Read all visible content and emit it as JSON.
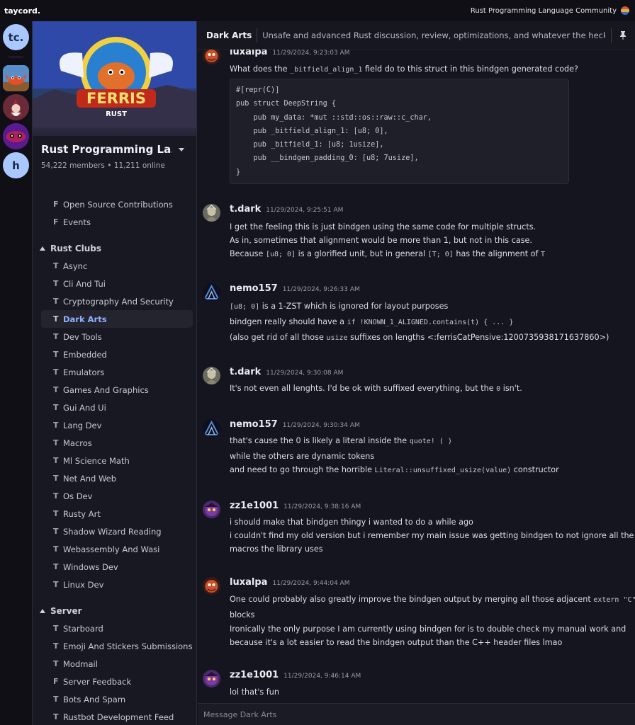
{
  "app": {
    "brand": "taycord.",
    "guild_title": "Rust Programming Language Community"
  },
  "rail": {
    "home_label": "tc.",
    "h_label": "h"
  },
  "server": {
    "banner_text": "FERRIS",
    "banner_sub": "RUST",
    "name": "Rust Programming La...",
    "stats": "54,222 members • 11,211 online"
  },
  "sidebar": {
    "top_channels": [
      {
        "type": "F",
        "name": "Open Source Contributions"
      },
      {
        "type": "F",
        "name": "Events"
      }
    ],
    "cat_clubs": "Rust Clubs",
    "clubs": [
      {
        "type": "T",
        "name": "Async"
      },
      {
        "type": "T",
        "name": "Cli And Tui"
      },
      {
        "type": "T",
        "name": "Cryptography And Security"
      },
      {
        "type": "T",
        "name": "Dark Arts"
      },
      {
        "type": "T",
        "name": "Dev Tools"
      },
      {
        "type": "T",
        "name": "Embedded"
      },
      {
        "type": "T",
        "name": "Emulators"
      },
      {
        "type": "T",
        "name": "Games And Graphics"
      },
      {
        "type": "T",
        "name": "Gui And Ui"
      },
      {
        "type": "T",
        "name": "Lang Dev"
      },
      {
        "type": "T",
        "name": "Macros"
      },
      {
        "type": "T",
        "name": "Ml Science Math"
      },
      {
        "type": "T",
        "name": "Net And Web"
      },
      {
        "type": "T",
        "name": "Os Dev"
      },
      {
        "type": "T",
        "name": "Rusty Art"
      },
      {
        "type": "T",
        "name": "Shadow Wizard Reading"
      },
      {
        "type": "T",
        "name": "Webassembly And Wasi"
      },
      {
        "type": "T",
        "name": "Windows Dev"
      },
      {
        "type": "T",
        "name": "Linux Dev"
      }
    ],
    "cat_server": "Server",
    "server_channels": [
      {
        "type": "T",
        "name": "Starboard"
      },
      {
        "type": "T",
        "name": "Emoji And Stickers Submissions"
      },
      {
        "type": "T",
        "name": "Modmail"
      },
      {
        "type": "F",
        "name": "Server Feedback"
      },
      {
        "type": "T",
        "name": "Bots And Spam"
      },
      {
        "type": "T",
        "name": "Rustbot Development Feed"
      }
    ]
  },
  "channel": {
    "title": "Dark Arts",
    "topic": "Unsafe and advanced Rust discussion, review, optimizations, and whatever the heck prov...",
    "composer_placeholder": "Message Dark Arts"
  },
  "messages": {
    "m1": {
      "author": "luxalpa",
      "time": "11/29/2024, 9:23:03 AM",
      "l1a": "What does the ",
      "l1code": "_bitfield_align_1",
      "l1b": " field do to this struct in this bindgen generated code?",
      "code": [
        "#[repr(C)]",
        "pub struct DeepString {",
        "    pub my_data: *mut ::std::os::raw::c_char,",
        "    pub _bitfield_align_1: [u8; 0],",
        "    pub _bitfield_1: [u8; 1usize],",
        "    pub __bindgen_padding_0: [u8; 7usize],",
        "}"
      ]
    },
    "m2": {
      "author": "t.dark",
      "time": "11/29/2024, 9:25:51 AM",
      "l1": "I get the feeling this is just bindgen using the same code for multiple structs.",
      "l2": "As in, sometimes that alignment would be more than 1, but not in this case.",
      "l3a": "Because ",
      "l3c1": "[u8; 0]",
      "l3b": " is a glorified unit, but in general ",
      "l3c2": "[T; 0]",
      "l3c": " has the alignment of ",
      "l3c3": "T"
    },
    "m3": {
      "author": "nemo157",
      "time": "11/29/2024, 9:26:33 AM",
      "l1c": "[u8; 0]",
      "l1": " is a 1-ZST which is ignored for layout purposes",
      "l2a": "bindgen really should have a ",
      "l2c": "if !KNOWN_1_ALIGNED.contains(t) { ... }",
      "l3a": "(also get rid of all those ",
      "l3c": "usize",
      "l3b": " suffixes on lengths <:ferrisCatPensive:1200735938171637860>)"
    },
    "m4": {
      "author": "t.dark",
      "time": "11/29/2024, 9:30:08 AM",
      "l1a": "It's not even all lenghts. I'd be ok with suffixed everything, but the ",
      "l1c": "0",
      "l1b": " isn't."
    },
    "m5": {
      "author": "nemo157",
      "time": "11/29/2024, 9:30:34 AM",
      "l1a": "that's cause the 0 is likely a literal inside the ",
      "l1c": "quote! ( )",
      "l2": "while the others are dynamic tokens",
      "l3a": "and need to go through the horrible ",
      "l3c": "Literal::unsuffixed_usize(value)",
      "l3b": " constructor"
    },
    "m6": {
      "author": "zz1e1001",
      "time": "11/29/2024, 9:38:16 AM",
      "l1": "i should make that bindgen thingy i wanted to do a while ago",
      "l2": "i couldn't find my old version but i remember my main issue was getting bindgen to not ignore all the",
      "l3": "macros the library uses"
    },
    "m7": {
      "author": "luxalpa",
      "time": "11/29/2024, 9:44:04 AM",
      "l1a": "One could probably also greatly improve the bindgen output by merging all those adjacent ",
      "l1c": "extern \"C\"",
      "l2": "blocks",
      "l3": "Ironically the only purpose I am currently using bindgen for is to double check my manual work and",
      "l4": "because it's a lot easier to read the bindgen output than the C++ header files lmao"
    },
    "m8": {
      "author": "zz1e1001",
      "time": "11/29/2024, 9:46:14 AM",
      "l1": "lol that's fun"
    }
  }
}
